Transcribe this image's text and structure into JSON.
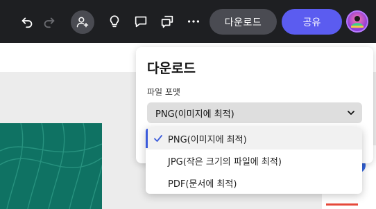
{
  "toolbar": {
    "download_label": "다운로드",
    "share_label": "공유"
  },
  "download_panel": {
    "title": "다운로드",
    "format_label": "파일 포맷",
    "selected_value": "PNG(이미지에 최적)",
    "options": [
      {
        "label": "PNG(이미지에 최적)",
        "selected": true
      },
      {
        "label": "JPG(작은 크기의 파일에 최적)",
        "selected": false
      },
      {
        "label": "PDF(문서에 최적)",
        "selected": false
      }
    ]
  },
  "colors": {
    "topbar": "#1e1f22",
    "share": "#5b5cf0",
    "accent": "#3b5bdb",
    "canvas_art": "#0f7263"
  }
}
